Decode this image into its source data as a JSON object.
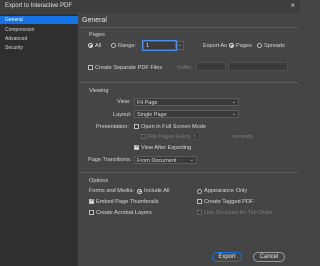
{
  "window": {
    "title": "Export to Interactive PDF",
    "close_glyph": "×"
  },
  "sidebar": {
    "items": [
      {
        "label": "General",
        "selected": true
      },
      {
        "label": "Compression"
      },
      {
        "label": "Advanced"
      },
      {
        "label": "Security"
      }
    ]
  },
  "main": {
    "title": "General"
  },
  "pages": {
    "group_label": "Pages",
    "all_label": "All",
    "range_label": "Range:",
    "range_value": "1",
    "export_as_label": "Export As",
    "pages_option": "Pages",
    "spreads_option": "Spreads",
    "separate_files_label": "Create Separate PDF Files",
    "suffix_label": "Suffix:"
  },
  "viewing": {
    "group_label": "Viewing",
    "view_label": "View:",
    "view_value": "Fit Page",
    "layout_label": "Layout:",
    "layout_value": "Single Page",
    "presentation_label": "Presentation:",
    "full_screen_label": "Open in Full Screen Mode",
    "flip_label": "Flip Pages Every:",
    "flip_value": "5",
    "seconds_label": "seconds",
    "view_after_label": "View After Exporting",
    "transitions_label": "Page Transitions:",
    "transitions_value": "From Document"
  },
  "options": {
    "group_label": "Options",
    "forms_label": "Forms and Media:",
    "include_all_label": "Include All",
    "appearance_only_label": "Appearance Only",
    "thumbnails_label": "Embed Page Thumbnails",
    "tagged_pdf_label": "Create Tagged PDF",
    "acrobat_layers_label": "Create Acrobat Layers",
    "tab_order_label": "Use Structure for Tab Order"
  },
  "buttons": {
    "export": "Export",
    "cancel": "Cancel"
  },
  "colors": {
    "accent": "#1473e6",
    "background": "#454545",
    "sidebar": "#2f2f2f"
  }
}
